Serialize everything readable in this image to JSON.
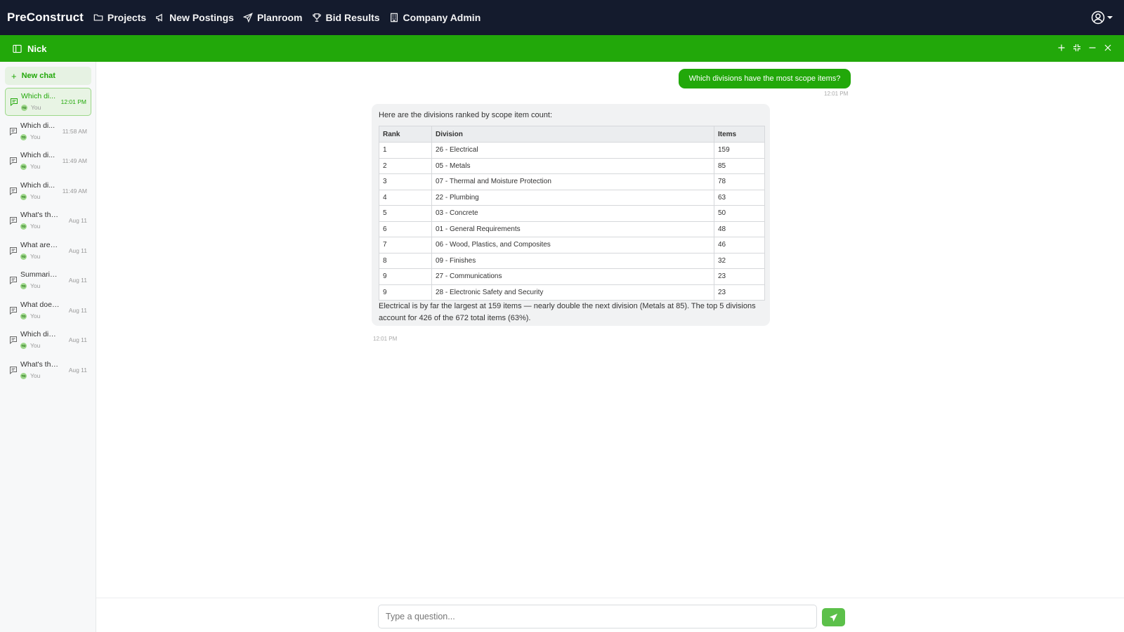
{
  "app": {
    "brand": "PreConstruct",
    "nav": [
      {
        "label": "Projects",
        "icon": "folder-icon"
      },
      {
        "label": "New Postings",
        "icon": "megaphone-icon"
      },
      {
        "label": "Planroom",
        "icon": "send-icon"
      },
      {
        "label": "Bid Results",
        "icon": "trophy-icon"
      },
      {
        "label": "Company Admin",
        "icon": "building-icon"
      }
    ],
    "user_icon": "user-circle-icon"
  },
  "assistant_bar": {
    "title": "Nick",
    "controls": [
      "plus-icon",
      "minimize-window-icon",
      "minus-icon",
      "close-icon"
    ]
  },
  "sidebar": {
    "new_chat_label": "New chat",
    "chats": [
      {
        "title": "Which di...",
        "author": "You",
        "avatar": "TD",
        "time": "12:01 PM",
        "active": true
      },
      {
        "title": "Which di...",
        "author": "You",
        "avatar": "TD",
        "time": "11:58 AM"
      },
      {
        "title": "Which di...",
        "author": "You",
        "avatar": "TD",
        "time": "11:49 AM"
      },
      {
        "title": "Which di...",
        "author": "You",
        "avatar": "TD",
        "time": "11:49 AM"
      },
      {
        "title": "What's the...",
        "author": "You",
        "avatar": "TD",
        "time": "Aug 11"
      },
      {
        "title": "What are t...",
        "author": "You",
        "avatar": "TD",
        "time": "Aug 11"
      },
      {
        "title": "Summarize...",
        "author": "You",
        "avatar": "TD",
        "time": "Aug 11"
      },
      {
        "title": "What does ...",
        "author": "You",
        "avatar": "TD",
        "time": "Aug 11"
      },
      {
        "title": "Which divi...",
        "author": "You",
        "avatar": "TD",
        "time": "Aug 11"
      },
      {
        "title": "What's the...",
        "author": "You",
        "avatar": "TD",
        "time": "Aug 11"
      }
    ]
  },
  "conversation": {
    "user_message": {
      "text": "Which divisions have the most scope items?",
      "time": "12:01 PM"
    },
    "assistant_message": {
      "intro": "Here are the divisions ranked by scope item count:",
      "columns": [
        "Rank",
        "Division",
        "Items"
      ],
      "rows": [
        [
          "1",
          "26 - Electrical",
          "159"
        ],
        [
          "2",
          "05 - Metals",
          "85"
        ],
        [
          "3",
          "07 - Thermal and Moisture Protection",
          "78"
        ],
        [
          "4",
          "22 - Plumbing",
          "63"
        ],
        [
          "5",
          "03 - Concrete",
          "50"
        ],
        [
          "6",
          "01 - General Requirements",
          "48"
        ],
        [
          "7",
          "06 - Wood, Plastics, and Composites",
          "46"
        ],
        [
          "8",
          "09 - Finishes",
          "32"
        ],
        [
          "9",
          "27 - Communications",
          "23"
        ],
        [
          "9",
          "28 - Electronic Safety and Security",
          "23"
        ]
      ],
      "summary": "Electrical is by far the largest at 159 items — nearly double the next division (Metals at 85). The top 5 divisions account for 426 of the 672 total items (63%).",
      "time": "12:01 PM"
    }
  },
  "composer": {
    "placeholder": "Type a question...",
    "send_icon": "send-icon"
  },
  "colors": {
    "nav_bg": "#141b2d",
    "accent_green": "#22a80a",
    "send_green": "#5cc04a"
  }
}
